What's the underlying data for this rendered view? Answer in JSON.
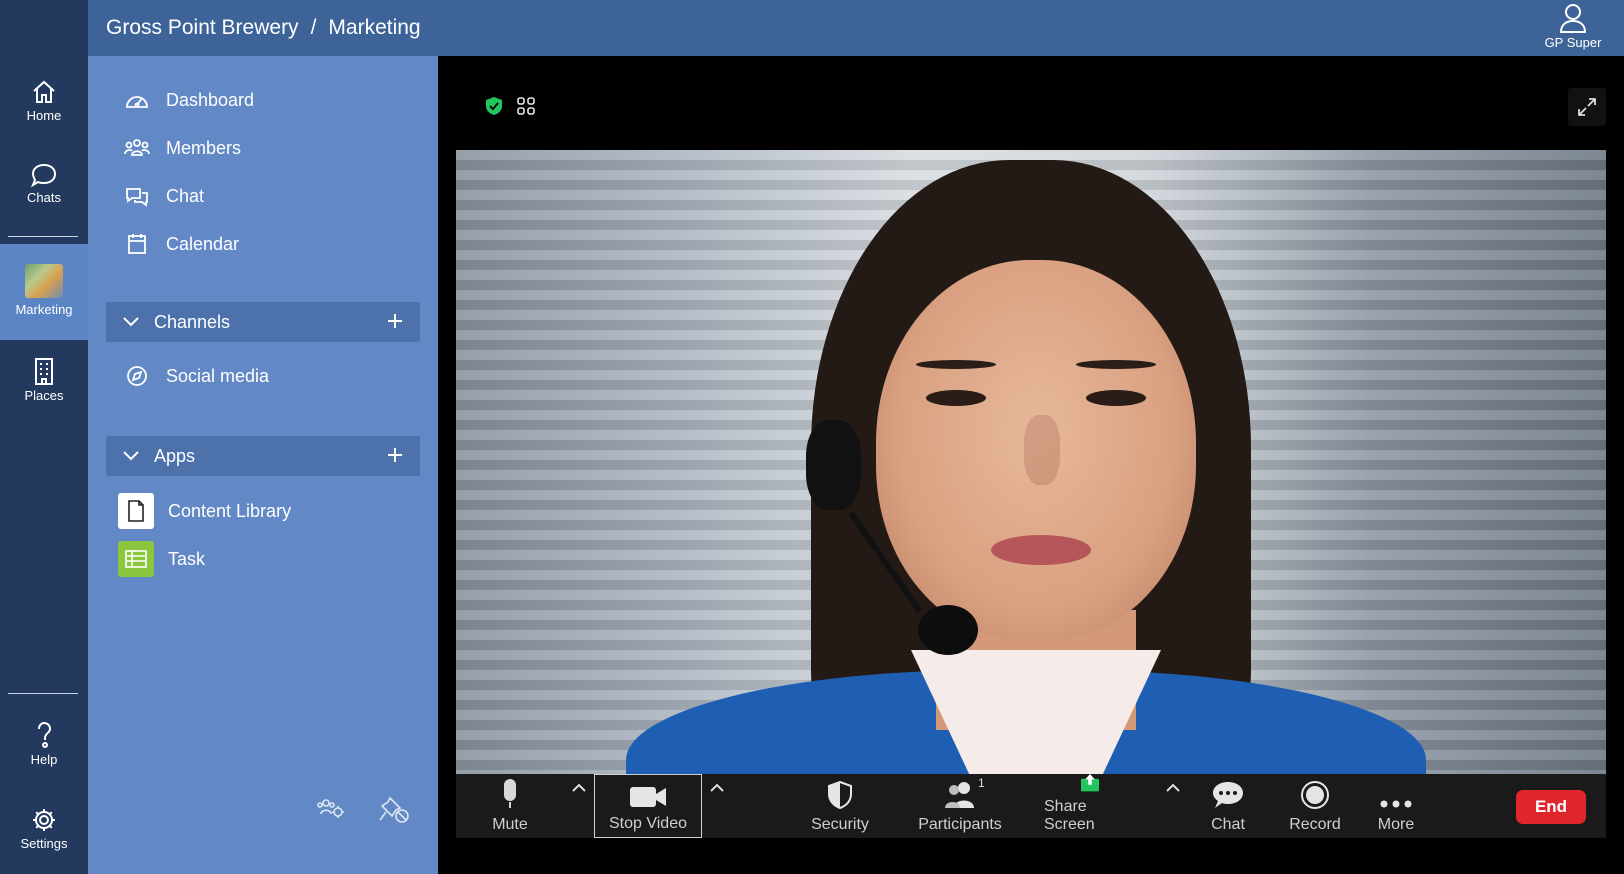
{
  "rail": {
    "items": [
      {
        "label": "Home",
        "icon": "home-icon"
      },
      {
        "label": "Chats",
        "icon": "chat-bubble-icon"
      },
      {
        "label": "Marketing",
        "icon": "workspace-avatar"
      },
      {
        "label": "Places",
        "icon": "building-icon"
      },
      {
        "label": "Help",
        "icon": "help-icon"
      },
      {
        "label": "Settings",
        "icon": "gear-icon"
      }
    ]
  },
  "header": {
    "org": "Gross Point Brewery",
    "separator": "/",
    "space": "Marketing",
    "user_name": "GP Super"
  },
  "sidebar": {
    "nav": [
      {
        "label": "Dashboard",
        "icon": "dashboard-icon"
      },
      {
        "label": "Members",
        "icon": "members-icon"
      },
      {
        "label": "Chat",
        "icon": "chat-icon"
      },
      {
        "label": "Calendar",
        "icon": "calendar-icon"
      }
    ],
    "channels_label": "Channels",
    "channels": [
      {
        "label": "Social media",
        "icon": "compass-icon"
      }
    ],
    "apps_label": "Apps",
    "apps": [
      {
        "label": "Content Library",
        "icon": "document-icon",
        "tile_color": "#ffffff"
      },
      {
        "label": "Task",
        "icon": "task-icon",
        "tile_color": "#8cc63f"
      }
    ]
  },
  "meeting": {
    "secure_color": "#22c55e",
    "toolbar": {
      "mute": "Mute",
      "stop_video": "Stop Video",
      "security": "Security",
      "participants": "Participants",
      "participants_count": "1",
      "share_screen": "Share Screen",
      "share_color": "#22c55e",
      "chat": "Chat",
      "record": "Record",
      "more": "More",
      "end": "End",
      "end_color": "#e0262d"
    }
  }
}
